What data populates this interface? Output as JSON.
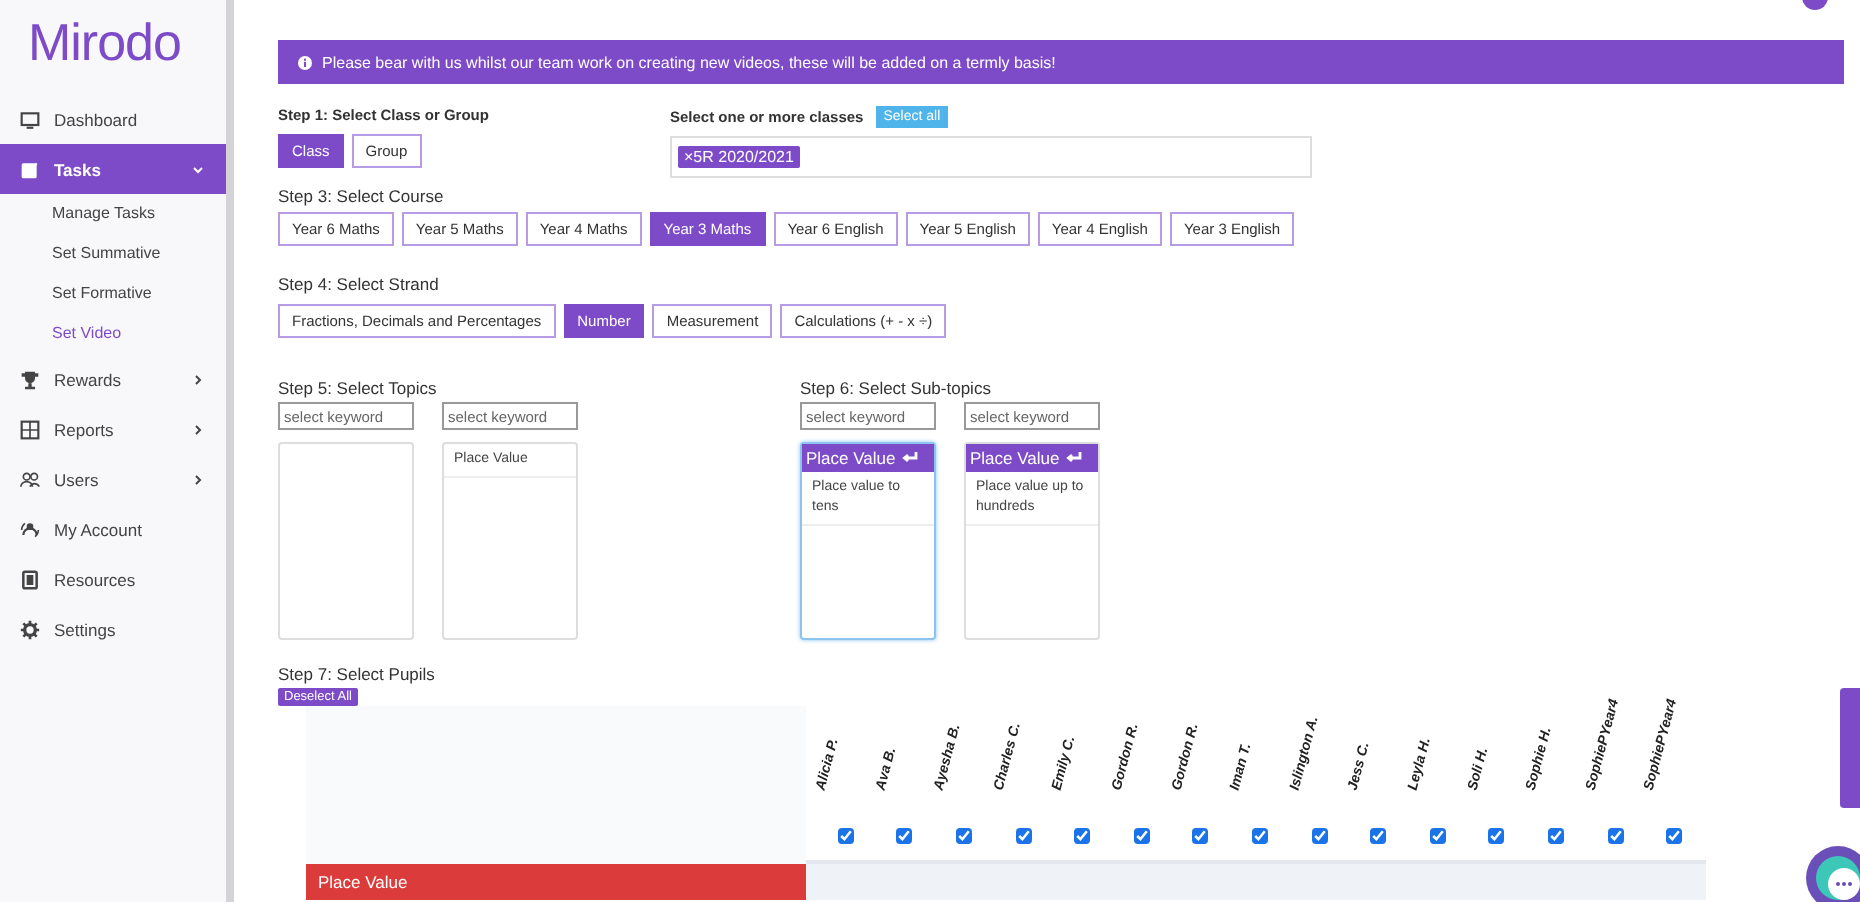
{
  "logo": "Mirodo",
  "sidebar": {
    "items": [
      {
        "label": "Dashboard",
        "selected": false
      },
      {
        "label": "Tasks",
        "selected": true,
        "expanded": true,
        "children": [
          {
            "label": "Manage Tasks",
            "selected": false
          },
          {
            "label": "Set Summative",
            "selected": false
          },
          {
            "label": "Set Formative",
            "selected": false
          },
          {
            "label": "Set Video",
            "selected": true
          }
        ]
      },
      {
        "label": "Rewards",
        "selected": false,
        "expanded": false
      },
      {
        "label": "Reports",
        "selected": false,
        "expanded": false
      },
      {
        "label": "Users",
        "selected": false,
        "expanded": false
      },
      {
        "label": "My Account",
        "selected": false
      },
      {
        "label": "Resources",
        "selected": false
      },
      {
        "label": "Settings",
        "selected": false
      }
    ]
  },
  "banner": "Please bear with us whilst our team work on creating new videos, these will be added on a termly basis!",
  "step1": {
    "label": "Step 1: Select Class or Group",
    "options": [
      {
        "label": "Class",
        "selected": true
      },
      {
        "label": "Group",
        "selected": false
      }
    ]
  },
  "classes": {
    "label": "Select one or more classes",
    "select_all": "Select all",
    "tags": [
      {
        "remove": "×",
        "label": "5R 2020/2021"
      }
    ]
  },
  "step3": {
    "label": "Step 3: Select Course",
    "options": [
      {
        "label": "Year 6 Maths",
        "selected": false
      },
      {
        "label": "Year 5 Maths",
        "selected": false
      },
      {
        "label": "Year 4 Maths",
        "selected": false
      },
      {
        "label": "Year 3 Maths",
        "selected": true
      },
      {
        "label": "Year 6 English",
        "selected": false
      },
      {
        "label": "Year 5 English",
        "selected": false
      },
      {
        "label": "Year 4 English",
        "selected": false
      },
      {
        "label": "Year 3 English",
        "selected": false
      }
    ]
  },
  "step4": {
    "label": "Step 4: Select Strand",
    "options": [
      {
        "label": "Fractions, Decimals and Percentages",
        "selected": false
      },
      {
        "label": "Number",
        "selected": true
      },
      {
        "label": "Measurement",
        "selected": false
      },
      {
        "label": "Calculations (+ - x ÷)",
        "selected": false
      }
    ]
  },
  "step5": {
    "label": "Step 5: Select Topics",
    "lists": [
      {
        "placeholder": "select keyword"
      },
      {
        "placeholder": "select keyword",
        "items": [
          {
            "label": "Place Value"
          }
        ]
      }
    ]
  },
  "step6": {
    "label": "Step 6: Select Sub-topics",
    "lists": [
      {
        "placeholder": "select keyword",
        "focused": true,
        "header": "Place Value",
        "items": [
          {
            "label": "Place value to tens"
          }
        ]
      },
      {
        "placeholder": "select keyword",
        "focused": false,
        "header": "Place Value",
        "items": [
          {
            "label": "Place value up to hundreds"
          }
        ]
      }
    ]
  },
  "step7": {
    "label": "Step 7: Select Pupils",
    "deselect_all": "Deselect All",
    "pupils": [
      {
        "name": "Alicia P.",
        "checked": true
      },
      {
        "name": "Ava B.",
        "checked": true
      },
      {
        "name": "Ayesha B.",
        "checked": true
      },
      {
        "name": "Charles C.",
        "checked": true
      },
      {
        "name": "Emily C.",
        "checked": true
      },
      {
        "name": "Gordon R.",
        "checked": true
      },
      {
        "name": "Gordon R.",
        "checked": true
      },
      {
        "name": "Iman T.",
        "checked": true
      },
      {
        "name": "Islington A.",
        "checked": true
      },
      {
        "name": "Jess C.",
        "checked": true
      },
      {
        "name": "Leyla H.",
        "checked": true
      },
      {
        "name": "Soli H.",
        "checked": true
      },
      {
        "name": "Sophie H.",
        "checked": true
      },
      {
        "name": "SophiePYear4",
        "checked": true
      },
      {
        "name": "SophiePYear4",
        "checked": true
      }
    ],
    "rows": [
      {
        "label": "Place Value"
      }
    ]
  }
}
